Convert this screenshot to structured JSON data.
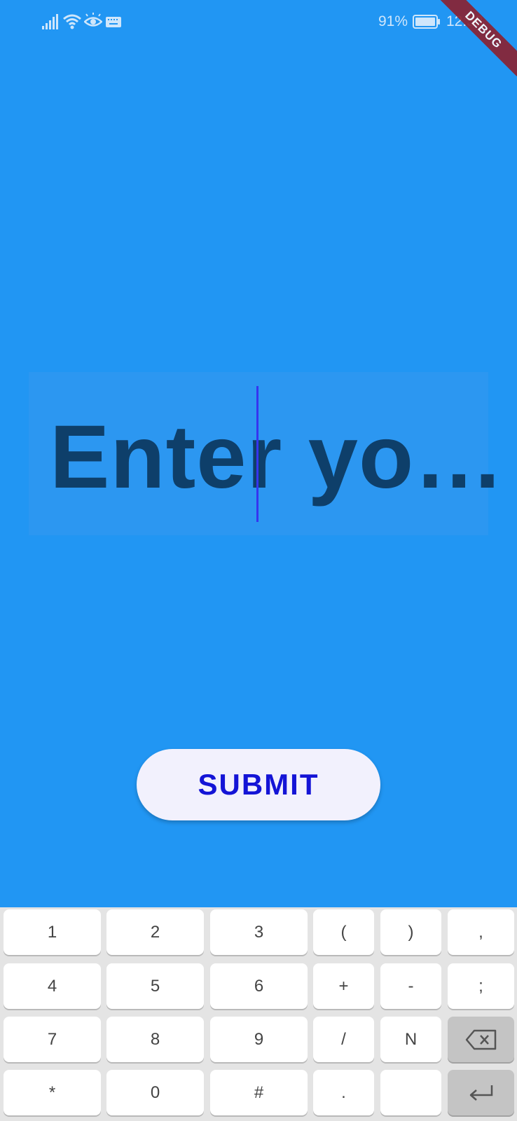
{
  "status_bar": {
    "battery_percent": "91%",
    "time": "12:58",
    "icons": [
      "signal-icon",
      "wifi-icon",
      "eye-icon",
      "keyboard-icon",
      "battery-icon"
    ]
  },
  "debug_banner": "DEBUG",
  "input": {
    "value": "Enter yo…"
  },
  "submit_label": "SUBMIT",
  "keyboard": {
    "rows": [
      [
        "1",
        "2",
        "3",
        "(",
        ")",
        ","
      ],
      [
        "4",
        "5",
        "6",
        "+",
        "-",
        ";"
      ],
      [
        "7",
        "8",
        "9",
        "/",
        "N",
        "backspace"
      ],
      [
        "*",
        "0",
        "#",
        ".",
        "",
        "enter"
      ]
    ]
  },
  "colors": {
    "background": "#2196F3",
    "input_background": "#2c97f1",
    "input_text": "#0e3f6a",
    "caret": "#3535f0",
    "button_background": "#f2f1fd",
    "button_text": "#1414d6",
    "debug_banner": "#8a2332"
  }
}
